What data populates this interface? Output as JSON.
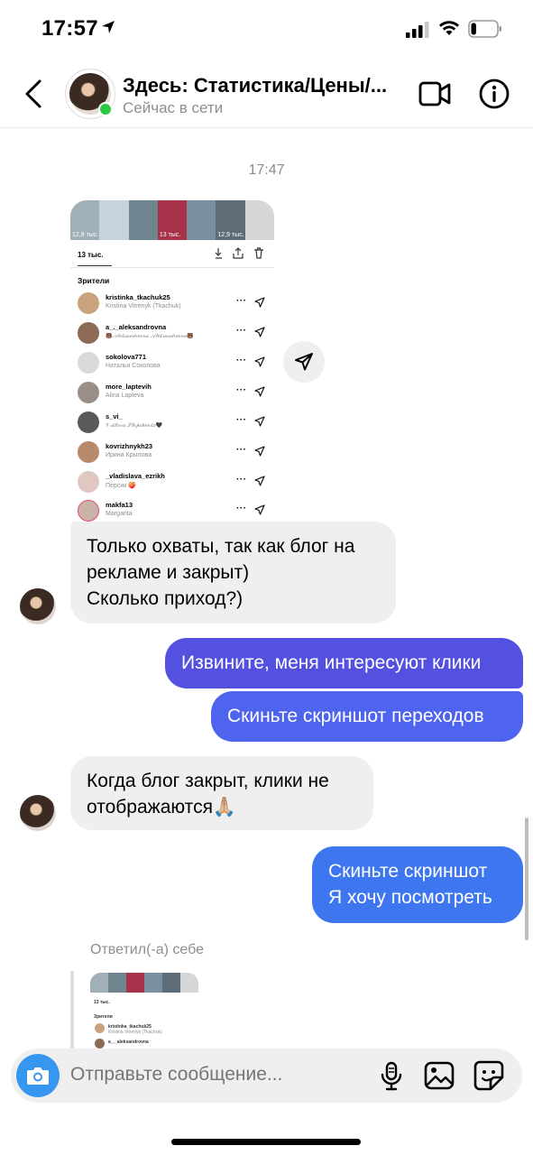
{
  "status_bar": {
    "time": "17:57",
    "battery_level": 0.2
  },
  "header": {
    "title": "Здесь: Статистика/Цены/...",
    "status": "Сейчас в сети"
  },
  "timestamp": "17:47",
  "screenshot": {
    "strip_counts": [
      "12,8 тыс.",
      "",
      "",
      "13 тыс.",
      "",
      "12,9 тыс.",
      ""
    ],
    "views": "13 тыс.",
    "viewers_title": "Зрители",
    "viewers": [
      {
        "username": "kristinka_tkachuk25",
        "name": "Kristina Vitrenyk (Tkachuk)",
        "color": "#caa27e"
      },
      {
        "username": "a_._aleksandrovna",
        "name": "🐻𝒜𝓁𝑒𝓀𝓈𝒶𝓃𝒹𝓇𝑜𝓋𝓃𝒶 𝒜𝓁𝑒𝓀𝓈𝒶𝓃𝒹𝓇𝑜𝓋𝓃𝒶🐻",
        "color": "#8c6a55"
      },
      {
        "username": "sokolova771",
        "name": "Наталья Соколова",
        "color": "#d9d9d9"
      },
      {
        "username": "more_laptevih",
        "name": "Alina Lapteva",
        "color": "#9a8f88"
      },
      {
        "username": "s_vi_",
        "name": "𝒱𝒾𝓀𝓉𝑜𝓇𝒾𝒶 𝒮𝓉𝑒𝓅𝒸𝒽𝑒𝓃𝓀𝑜🖤",
        "color": "#5a5a5a"
      },
      {
        "username": "kovrizhnykh23",
        "name": "Ирина Крылова",
        "color": "#b88a6b"
      },
      {
        "username": "_vladislava_ezrikh",
        "name": "Персик 🍑",
        "color": "#e0c7c2"
      },
      {
        "username": "makfa13",
        "name": "Margarita",
        "color": "#c9b3a8"
      }
    ]
  },
  "messages": {
    "m1": [
      "Только охваты, так как блог на",
      "рекламе и закрыт)",
      "Сколько приход?)"
    ],
    "m2": "Извините, меня интересуют клики",
    "m3": "Скиньте скриншот переходов",
    "m4": [
      "Когда блог закрыт, клики не",
      "отображаются🙏🏼"
    ],
    "m5": [
      "Скиньте скриншот",
      "Я хочу посмотреть"
    ]
  },
  "reply": {
    "label": "Ответил(-а) себе",
    "views": "13 тыс.",
    "viewers_title": "Зрители",
    "row1_user": "kristinka_tkachuk25",
    "row1_name": "Kristina Vitrenyk (Tkachuk)",
    "row2_user": "a_._aleksandrovna"
  },
  "composer": {
    "placeholder": "Отправьте сообщение..."
  },
  "colors": {
    "accent": "#3797f0",
    "outgoing": "#5551e0",
    "online": "#2ac940"
  },
  "icons": [
    "location-arrow-icon",
    "signal-icon",
    "wifi-icon",
    "battery-icon",
    "back-icon",
    "video-call-icon",
    "info-icon",
    "send-icon",
    "camera-icon",
    "mic-icon",
    "gallery-icon",
    "sticker-icon"
  ]
}
